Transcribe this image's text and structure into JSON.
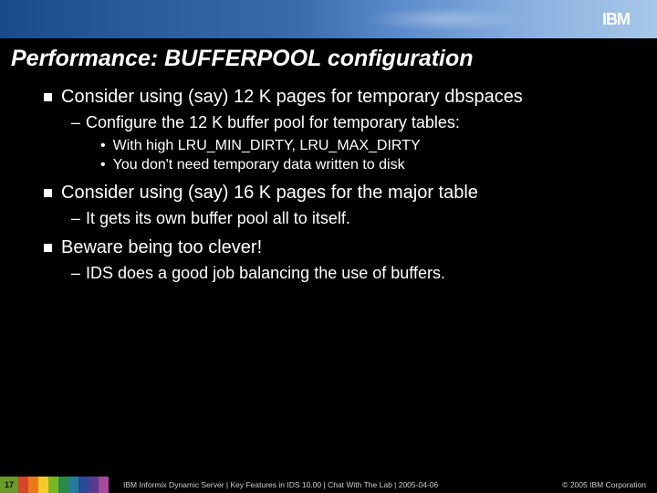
{
  "logo": "IBM",
  "title": "Performance: BUFFERPOOL configuration",
  "b1": {
    "text": "Consider using (say) 12 K pages for temporary dbspaces",
    "sub1": "Configure the 12 K buffer pool for temporary tables:",
    "dot1": "With high LRU_MIN_DIRTY, LRU_MAX_DIRTY",
    "dot2": "You don't need temporary data written to disk"
  },
  "b2": {
    "text": "Consider using (say) 16 K pages for the major table",
    "sub1": "It gets its own buffer pool all to itself."
  },
  "b3": {
    "text": "Beware being too clever!",
    "sub1": "IDS does a good job balancing the use of buffers."
  },
  "footer": {
    "page": "17",
    "center": "IBM Informix Dynamic Server | Key Features in IDS 10.00 | Chat With The Lab | 2005-04-06",
    "right": "© 2005 IBM Corporation"
  },
  "stripColors": [
    "#d8442a",
    "#e87a1a",
    "#f4cc2a",
    "#7ab82a",
    "#2a8a4a",
    "#2a7a9a",
    "#2a4a9a",
    "#5a3a8a",
    "#a84a9a"
  ]
}
